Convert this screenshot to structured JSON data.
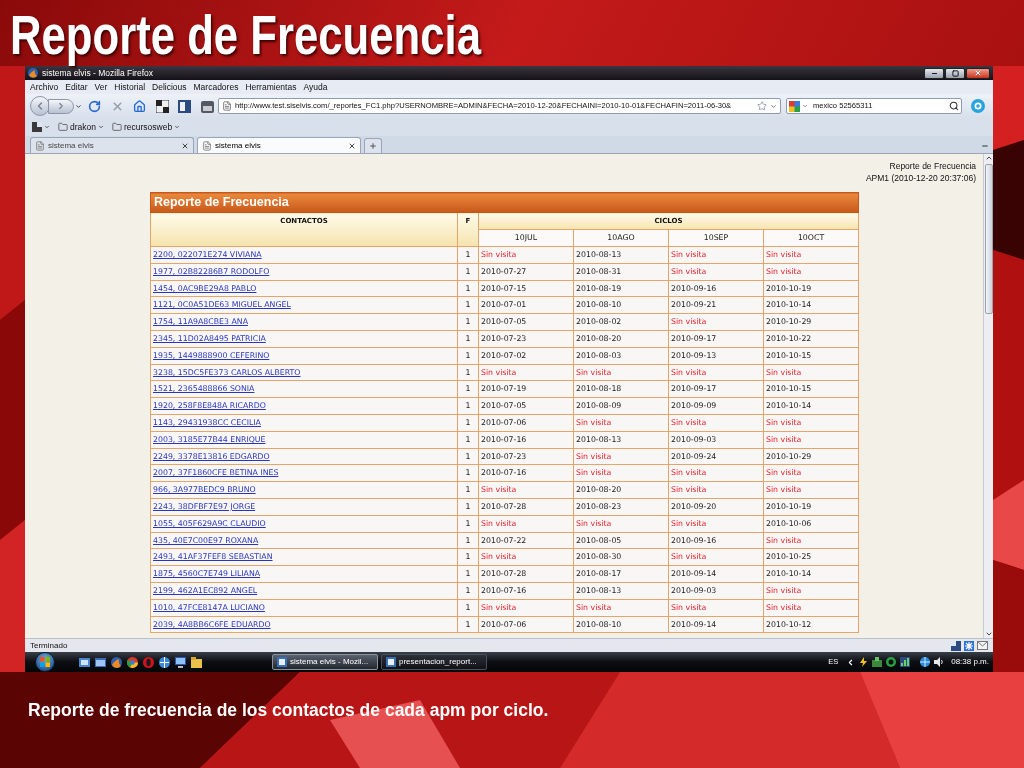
{
  "slide": {
    "title": "Reporte de Frecuencia",
    "caption": "Reporte de frecuencia de los contactos de cada apm por ciclo."
  },
  "window": {
    "title": "sistema elvis - Mozilla Firefox"
  },
  "menu": [
    "Archivo",
    "Editar",
    "Ver",
    "Historial",
    "Delicious",
    "Marcadores",
    "Herramientas",
    "Ayuda"
  ],
  "address_bar": {
    "value": "http://www.test.siselvis.com/_reportes_FC1.php?USERNOMBRE=ADMIN&FECHA=2010-12-20&FECHAINI=2010-10-01&FECHAFIN=2011-06-30&"
  },
  "search": {
    "value": "mexico 52565311"
  },
  "bookmarks": [
    {
      "label": "drakon"
    },
    {
      "label": "recursosweb"
    }
  ],
  "tabs": [
    {
      "label": "sistema elvis",
      "selected": false
    },
    {
      "label": "sistema elvis",
      "selected": true
    }
  ],
  "page": {
    "header_lines": [
      "Reporte de Frecuencia",
      "APM1 (2010-12-20 20:37:06)"
    ],
    "table": {
      "title": "Reporte de Frecuencia",
      "columns": [
        "CONTACTOS",
        "F"
      ],
      "group_header": "CICLOS",
      "cycles": [
        "10JUL",
        "10AGO",
        "10SEP",
        "10OCT"
      ],
      "rows": [
        {
          "contact": "2200, 022071E274 VIVIANA",
          "f": "1",
          "cells": [
            {
              "text": "Sin visita",
              "kind": "missed"
            },
            {
              "text": "2010-08-13",
              "kind": "date"
            },
            {
              "text": "Sin visita",
              "kind": "missed"
            },
            {
              "text": "Sin visita",
              "kind": "missed"
            }
          ]
        },
        {
          "contact": "1977, 02B82286B7 RODOLFO",
          "f": "1",
          "cells": [
            {
              "text": "2010-07-27",
              "kind": "date"
            },
            {
              "text": "2010-08-31",
              "kind": "date"
            },
            {
              "text": "Sin visita",
              "kind": "missed"
            },
            {
              "text": "Sin visita",
              "kind": "missed"
            }
          ]
        },
        {
          "contact": "1454, 0AC9BE29A8 PABLO",
          "f": "1",
          "cells": [
            {
              "text": "2010-07-15",
              "kind": "date"
            },
            {
              "text": "2010-08-19",
              "kind": "date"
            },
            {
              "text": "2010-09-16",
              "kind": "date"
            },
            {
              "text": "2010-10-19",
              "kind": "date"
            }
          ]
        },
        {
          "contact": "1121, 0C0A51DE63 MIGUEL ANGEL",
          "f": "1",
          "cells": [
            {
              "text": "2010-07-01",
              "kind": "date"
            },
            {
              "text": "2010-08-10",
              "kind": "date"
            },
            {
              "text": "2010-09-21",
              "kind": "date"
            },
            {
              "text": "2010-10-14",
              "kind": "date"
            }
          ]
        },
        {
          "contact": "1754, 11A9A8CBE3 ANA",
          "f": "1",
          "cells": [
            {
              "text": "2010-07-05",
              "kind": "date"
            },
            {
              "text": "2010-08-02",
              "kind": "date"
            },
            {
              "text": "Sin visita",
              "kind": "missed"
            },
            {
              "text": "2010-10-29",
              "kind": "date"
            }
          ]
        },
        {
          "contact": "2345, 11D02A8495 PATRICIA",
          "f": "1",
          "cells": [
            {
              "text": "2010-07-23",
              "kind": "date"
            },
            {
              "text": "2010-08-20",
              "kind": "date"
            },
            {
              "text": "2010-09-17",
              "kind": "date"
            },
            {
              "text": "2010-10-22",
              "kind": "date"
            }
          ]
        },
        {
          "contact": "1935, 1449888900 CEFERINO",
          "f": "1",
          "cells": [
            {
              "text": "2010-07-02",
              "kind": "date"
            },
            {
              "text": "2010-08-03",
              "kind": "date"
            },
            {
              "text": "2010-09-13",
              "kind": "date"
            },
            {
              "text": "2010-10-15",
              "kind": "date"
            }
          ]
        },
        {
          "contact": "3238, 15DC5FE373 CARLOS ALBERTO",
          "f": "1",
          "cells": [
            {
              "text": "Sin visita",
              "kind": "missed"
            },
            {
              "text": "Sin visita",
              "kind": "missed"
            },
            {
              "text": "Sin visita",
              "kind": "missed"
            },
            {
              "text": "Sin visita",
              "kind": "missed"
            }
          ]
        },
        {
          "contact": "1521, 2365488866 SONIA",
          "f": "1",
          "cells": [
            {
              "text": "2010-07-19",
              "kind": "date"
            },
            {
              "text": "2010-08-18",
              "kind": "date"
            },
            {
              "text": "2010-09-17",
              "kind": "date"
            },
            {
              "text": "2010-10-15",
              "kind": "date"
            }
          ]
        },
        {
          "contact": "1920, 258F8E848A RICARDO",
          "f": "1",
          "cells": [
            {
              "text": "2010-07-05",
              "kind": "date"
            },
            {
              "text": "2010-08-09",
              "kind": "date"
            },
            {
              "text": "2010-09-09",
              "kind": "date"
            },
            {
              "text": "2010-10-14",
              "kind": "date"
            }
          ]
        },
        {
          "contact": "1143, 29431938CC CECILIA",
          "f": "1",
          "cells": [
            {
              "text": "2010-07-06",
              "kind": "date"
            },
            {
              "text": "Sin visita",
              "kind": "missed"
            },
            {
              "text": "Sin visita",
              "kind": "missed"
            },
            {
              "text": "Sin visita",
              "kind": "missed"
            }
          ]
        },
        {
          "contact": "2003, 3185E77B44 ENRIQUE",
          "f": "1",
          "cells": [
            {
              "text": "2010-07-16",
              "kind": "date"
            },
            {
              "text": "2010-08-13",
              "kind": "date"
            },
            {
              "text": "2010-09-03",
              "kind": "date"
            },
            {
              "text": "Sin visita",
              "kind": "missed"
            }
          ]
        },
        {
          "contact": "2249, 3378E13816 EDGARDO",
          "f": "1",
          "cells": [
            {
              "text": "2010-07-23",
              "kind": "date"
            },
            {
              "text": "Sin visita",
              "kind": "missed"
            },
            {
              "text": "2010-09-24",
              "kind": "date"
            },
            {
              "text": "2010-10-29",
              "kind": "date"
            }
          ]
        },
        {
          "contact": "2007, 37F1860CFE BETINA INES",
          "f": "1",
          "cells": [
            {
              "text": "2010-07-16",
              "kind": "date"
            },
            {
              "text": "Sin visita",
              "kind": "missed"
            },
            {
              "text": "Sin visita",
              "kind": "missed"
            },
            {
              "text": "Sin visita",
              "kind": "missed"
            }
          ]
        },
        {
          "contact": "966, 3A977BEDC9 BRUNO",
          "f": "1",
          "cells": [
            {
              "text": "Sin visita",
              "kind": "missed"
            },
            {
              "text": "2010-08-20",
              "kind": "date"
            },
            {
              "text": "Sin visita",
              "kind": "missed"
            },
            {
              "text": "Sin visita",
              "kind": "missed"
            }
          ]
        },
        {
          "contact": "2243, 38DFBF7E97 JORGE",
          "f": "1",
          "cells": [
            {
              "text": "2010-07-28",
              "kind": "date"
            },
            {
              "text": "2010-08-23",
              "kind": "date"
            },
            {
              "text": "2010-09-20",
              "kind": "date"
            },
            {
              "text": "2010-10-19",
              "kind": "date"
            }
          ]
        },
        {
          "contact": "1055, 405F629A9C CLAUDIO",
          "f": "1",
          "cells": [
            {
              "text": "Sin visita",
              "kind": "missed"
            },
            {
              "text": "Sin visita",
              "kind": "missed"
            },
            {
              "text": "Sin visita",
              "kind": "missed"
            },
            {
              "text": "2010-10-06",
              "kind": "date"
            }
          ]
        },
        {
          "contact": "435, 40E7C00E97 ROXANA",
          "f": "1",
          "cells": [
            {
              "text": "2010-07-22",
              "kind": "date"
            },
            {
              "text": "2010-08-05",
              "kind": "date"
            },
            {
              "text": "2010-09-16",
              "kind": "date"
            },
            {
              "text": "Sin visita",
              "kind": "missed"
            }
          ]
        },
        {
          "contact": "2493, 41AF37FEF8 SEBASTIAN",
          "f": "1",
          "cells": [
            {
              "text": "Sin visita",
              "kind": "missed"
            },
            {
              "text": "2010-08-30",
              "kind": "date"
            },
            {
              "text": "Sin visita",
              "kind": "missed"
            },
            {
              "text": "2010-10-25",
              "kind": "date"
            }
          ]
        },
        {
          "contact": "1875, 4560C7E749 LILIANA",
          "f": "1",
          "cells": [
            {
              "text": "2010-07-28",
              "kind": "date"
            },
            {
              "text": "2010-08-17",
              "kind": "date"
            },
            {
              "text": "2010-09-14",
              "kind": "date"
            },
            {
              "text": "2010-10-14",
              "kind": "date"
            }
          ]
        },
        {
          "contact": "2199, 462A1EC892 ANGEL",
          "f": "1",
          "cells": [
            {
              "text": "2010-07-16",
              "kind": "date"
            },
            {
              "text": "2010-08-13",
              "kind": "date"
            },
            {
              "text": "2010-09-03",
              "kind": "date"
            },
            {
              "text": "Sin visita",
              "kind": "missed"
            }
          ]
        },
        {
          "contact": "1010, 47FCE8147A LUCIANO",
          "f": "1",
          "cells": [
            {
              "text": "Sin visita",
              "kind": "missed"
            },
            {
              "text": "Sin visita",
              "kind": "missed"
            },
            {
              "text": "Sin visita",
              "kind": "missed"
            },
            {
              "text": "Sin visita",
              "kind": "missed"
            }
          ]
        },
        {
          "contact": "2039, 4A8BB6C6FE EDUARDO",
          "f": "1",
          "cells": [
            {
              "text": "2010-07-06",
              "kind": "date"
            },
            {
              "text": "2010-08-10",
              "kind": "date"
            },
            {
              "text": "2010-09-14",
              "kind": "date"
            },
            {
              "text": "2010-10-12",
              "kind": "date"
            }
          ]
        }
      ]
    }
  },
  "status_bar": {
    "text": "Terminado"
  },
  "taskbar": {
    "tasks": [
      {
        "label": "sistema elvis - Mozil...",
        "selected": true
      },
      {
        "label": "presentacion_report...",
        "selected": false
      }
    ],
    "language": "ES",
    "clock": "08:38 p.m."
  }
}
